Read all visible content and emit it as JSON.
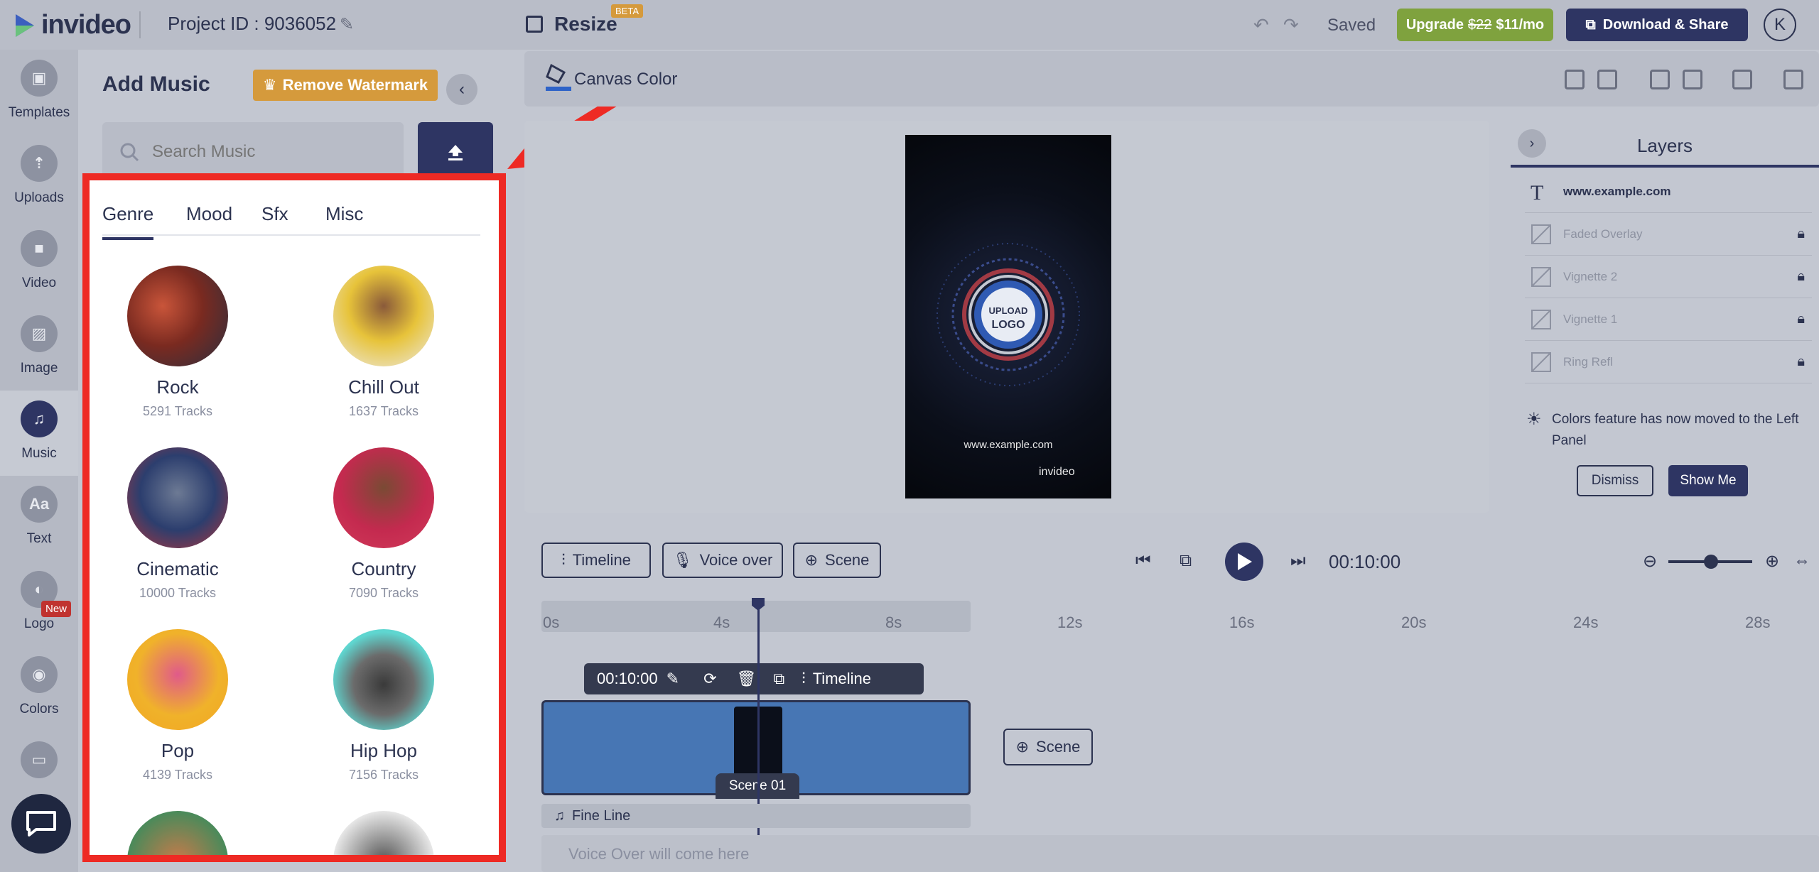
{
  "header": {
    "brand": "invideo",
    "project_id": "Project ID : 9036052",
    "resize_label": "Resize",
    "beta_badge": "BETA",
    "saved_label": "Saved",
    "upgrade_label": "Upgrade",
    "upgrade_old_price": "$22",
    "upgrade_new_price": "$11/mo",
    "download_label": "Download & Share",
    "avatar_initial": "K"
  },
  "rail": {
    "items": [
      {
        "label": "Templates"
      },
      {
        "label": "Uploads"
      },
      {
        "label": "Video"
      },
      {
        "label": "Image"
      },
      {
        "label": "Music"
      },
      {
        "label": "Text"
      },
      {
        "label": "Logo"
      },
      {
        "label": "Colors"
      }
    ],
    "new_badge": "New"
  },
  "panel": {
    "title": "Add Music",
    "watermark_label": "Remove Watermark",
    "search_placeholder": "Search Music",
    "tabs": [
      "Genre",
      "Mood",
      "Sfx",
      "Misc"
    ],
    "genres": [
      {
        "name": "Rock",
        "count": "5291 Tracks"
      },
      {
        "name": "Chill Out",
        "count": "1637 Tracks"
      },
      {
        "name": "Cinematic",
        "count": "10000 Tracks"
      },
      {
        "name": "Country",
        "count": "7090 Tracks"
      },
      {
        "name": "Pop",
        "count": "4139 Tracks"
      },
      {
        "name": "Hip Hop",
        "count": "7156 Tracks"
      }
    ]
  },
  "canvas": {
    "color_label": "Canvas Color",
    "frame_url": "www.example.com",
    "frame_brand": "invideo",
    "upload_logo_line1": "UPLOAD",
    "upload_logo_line2": "LOGO"
  },
  "layers": {
    "title": "Layers",
    "items": [
      {
        "name": "www.example.com"
      },
      {
        "name": "Faded Overlay"
      },
      {
        "name": "Vignette 2"
      },
      {
        "name": "Vignette 1"
      },
      {
        "name": "Ring Refl"
      }
    ]
  },
  "notice": {
    "text": "Colors feature has now moved to the Left Panel",
    "dismiss_label": "Dismiss",
    "show_me_label": "Show Me"
  },
  "timeline": {
    "timeline_label": "Timeline",
    "voiceover_label": "Voice over",
    "scene_label": "Scene",
    "time": "00:10:00",
    "ticks": [
      "0s",
      "4s",
      "8s",
      "12s",
      "16s",
      "20s",
      "24s",
      "28s"
    ],
    "scene_duration": "00:10:00",
    "scene_tools_timeline": "Timeline",
    "scene_name": "Scene 01",
    "add_scene_label": "Scene",
    "audio_track": "Fine Line",
    "voice_placeholder": "Voice Over will come here"
  },
  "colors": {
    "accent": "#2e3563",
    "highlight": "#ee2a24",
    "upgrade": "#7fa23e",
    "watermark": "#d59a3c",
    "clip": "#4776b4"
  }
}
